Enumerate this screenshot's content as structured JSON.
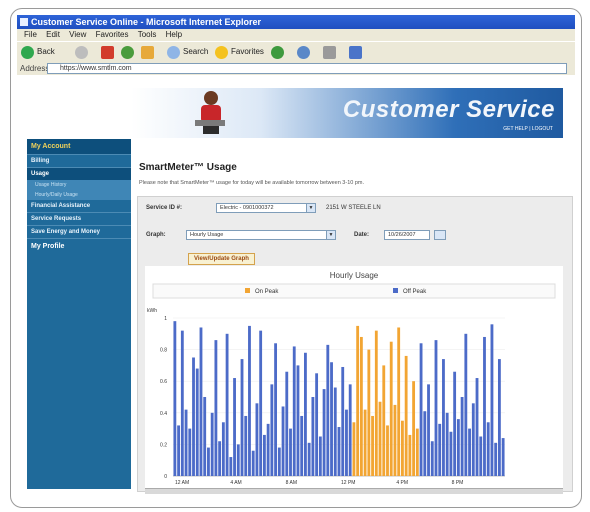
{
  "window": {
    "title": "Customer Service Online - Microsoft Internet Explorer"
  },
  "menu": [
    "File",
    "Edit",
    "View",
    "Favorites",
    "Tools",
    "Help"
  ],
  "toolbar": {
    "back": "Back",
    "search": "Search",
    "favorites": "Favorites"
  },
  "address": {
    "label": "Address",
    "url": "https://www.smtlm.com"
  },
  "banner": {
    "title": "Customer Service",
    "links": "GET HELP | LOGOUT"
  },
  "nav": {
    "my_account": "My Account",
    "billing": "Billing",
    "usage": "Usage",
    "usage_sub": [
      "Usage History",
      "Hourly/Daily Usage"
    ],
    "financial": "Financial Assistance",
    "service": "Service Requests",
    "save": "Save Energy and Money",
    "profile": "My Profile"
  },
  "page": {
    "title": "SmartMeter™ Usage",
    "note": "Please note that SmartMeter™ usage for today will be available tomorrow between 3-10 pm.",
    "service_label": "Service ID #:",
    "service_value": "Electric - 0901000372",
    "address_text": "2151 W STEELE LN",
    "graph_label": "Graph:",
    "graph_value": "Hourly Usage",
    "date_label": "Date:",
    "date_value": "10/26/2007",
    "button": "View/Update Graph"
  },
  "chart_data": {
    "type": "bar",
    "title": "Hourly Usage",
    "legend": [
      "On Peak",
      "Off Peak"
    ],
    "ylabel": "kWh",
    "ylim": [
      0,
      1
    ],
    "yticks": [
      0,
      0.2,
      0.4,
      0.6,
      0.8,
      1
    ],
    "xticks": [
      "12 AM",
      "4 AM",
      "8 AM",
      "12 PM",
      "4 PM",
      "8 PM"
    ],
    "colors": {
      "on_peak": "#f2a533",
      "off_peak": "#4c6bc8"
    },
    "values": [
      0.98,
      0.32,
      0.92,
      0.42,
      0.3,
      0.75,
      0.68,
      0.94,
      0.5,
      0.18,
      0.4,
      0.86,
      0.22,
      0.34,
      0.9,
      0.12,
      0.62,
      0.2,
      0.74,
      0.38,
      0.95,
      0.16,
      0.46,
      0.92,
      0.26,
      0.33,
      0.58,
      0.84,
      0.18,
      0.44,
      0.66,
      0.3,
      0.82,
      0.7,
      0.38,
      0.78,
      0.21,
      0.5,
      0.65,
      0.25,
      0.55,
      0.83,
      0.72,
      0.56,
      0.31,
      0.69,
      0.42,
      0.58,
      0.34,
      0.95,
      0.88,
      0.42,
      0.8,
      0.38,
      0.92,
      0.47,
      0.7,
      0.32,
      0.85,
      0.45,
      0.94,
      0.35,
      0.76,
      0.26,
      0.6,
      0.3,
      0.84,
      0.41,
      0.58,
      0.22,
      0.86,
      0.33,
      0.74,
      0.4,
      0.28,
      0.66,
      0.36,
      0.5,
      0.9,
      0.3,
      0.46,
      0.62,
      0.25,
      0.88,
      0.34,
      0.96,
      0.21,
      0.74,
      0.24
    ],
    "peak_range": [
      48,
      65
    ]
  }
}
